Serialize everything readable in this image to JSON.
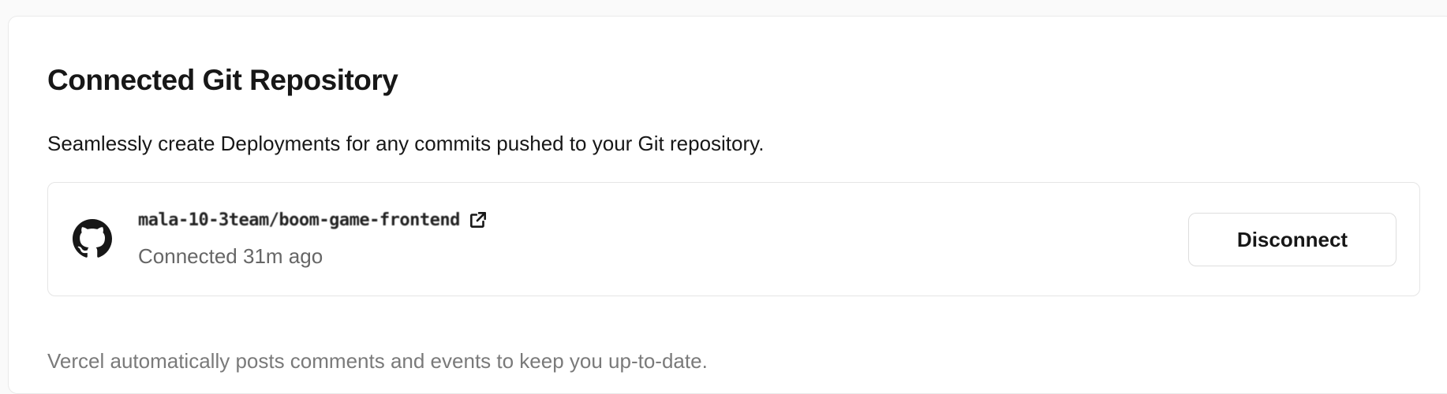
{
  "section": {
    "title": "Connected Git Repository",
    "description": "Seamlessly create Deployments for any commits pushed to your Git repository.",
    "footer": "Vercel automatically posts comments and events to keep you up-to-date."
  },
  "repository": {
    "provider_icon": "github-icon",
    "name": "mala-10-3team/boom-game-frontend",
    "external_link_icon": "external-link-icon",
    "status": "Connected 31m ago",
    "disconnect_label": "Disconnect"
  }
}
